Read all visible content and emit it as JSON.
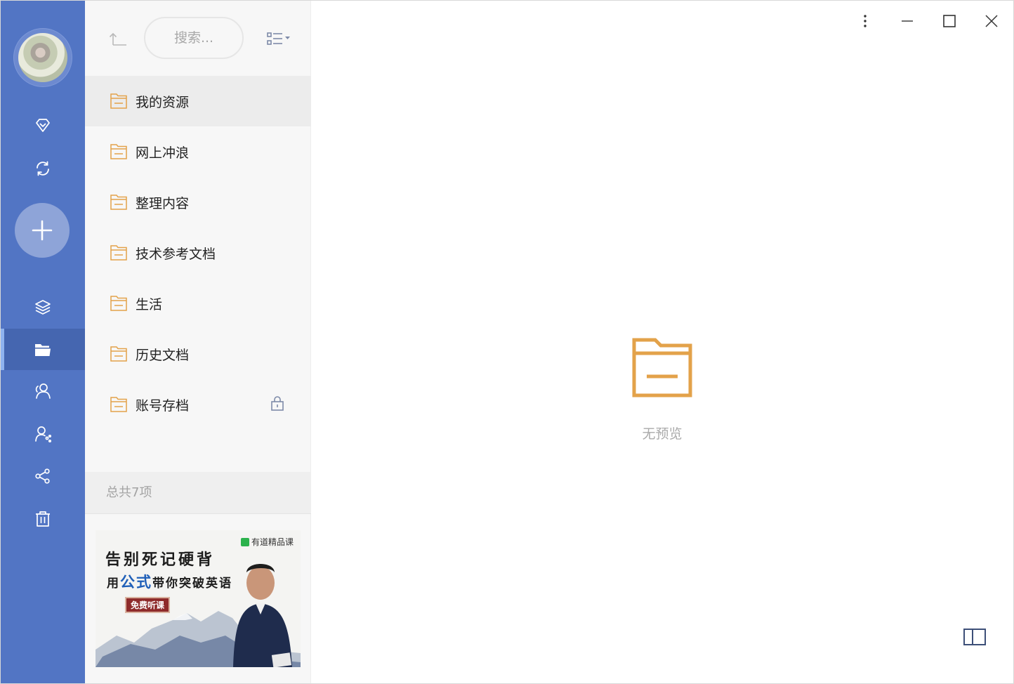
{
  "sidebar": {
    "avatar": "user-avatar",
    "nav": [
      {
        "icon": "diamond-icon",
        "name": "vip"
      },
      {
        "icon": "sync-icon",
        "name": "sync"
      },
      {
        "icon": "plus-icon",
        "name": "add"
      },
      {
        "icon": "layers-icon",
        "name": "layers"
      },
      {
        "icon": "folder-open-icon",
        "name": "folders",
        "active": true
      },
      {
        "icon": "person-icon",
        "name": "contacts"
      },
      {
        "icon": "group-icon",
        "name": "group"
      },
      {
        "icon": "share-icon",
        "name": "share"
      },
      {
        "icon": "trash-icon",
        "name": "trash"
      }
    ],
    "colors": {
      "rail": "#5275c4",
      "active": "#4566b0",
      "accent": "#8fb3ef"
    }
  },
  "toolbar": {
    "search_placeholder": "搜索..."
  },
  "folders": [
    {
      "name": "我的资源",
      "selected": true
    },
    {
      "name": "网上冲浪"
    },
    {
      "name": "整理内容"
    },
    {
      "name": "技术参考文档"
    },
    {
      "name": "生活"
    },
    {
      "name": "历史文档"
    },
    {
      "name": "账号存档",
      "locked": true
    }
  ],
  "footer": {
    "count_text": "总共7项"
  },
  "ad": {
    "brand": "有道精品课",
    "line1": "告别死记硬背",
    "line2_a": "用",
    "line2_hl": "公式",
    "line2_b": "带你突破英语",
    "tag": "免费听课"
  },
  "preview": {
    "empty_text": "无预览",
    "icon": "folder-icon",
    "folder_color": "#e3a24a"
  }
}
